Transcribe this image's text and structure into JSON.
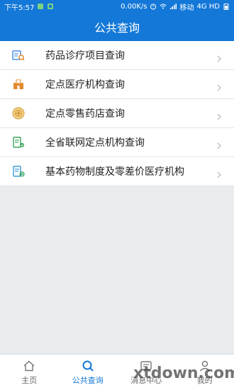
{
  "status_bar": {
    "time": "下午5:57",
    "network_speed": "0.00K/s",
    "carrier": "移动",
    "network_type": "4G HD"
  },
  "header": {
    "title": "公共查询"
  },
  "menu": {
    "items": [
      {
        "label": "药品诊疗项目查询",
        "icon": "medicine-search-icon"
      },
      {
        "label": "定点医疗机构查询",
        "icon": "hospital-icon"
      },
      {
        "label": "定点零售药店查询",
        "icon": "pharmacy-icon"
      },
      {
        "label": "全省联网定点机构查询",
        "icon": "network-institution-icon"
      },
      {
        "label": "基本药物制度及零差价医疗机构",
        "icon": "essential-drug-icon"
      }
    ]
  },
  "bottom_nav": {
    "items": [
      {
        "label": "主页",
        "icon": "home-icon",
        "active": false
      },
      {
        "label": "公共查询",
        "icon": "search-icon",
        "active": true
      },
      {
        "label": "消息中心",
        "icon": "message-icon",
        "active": false
      },
      {
        "label": "我的",
        "icon": "profile-icon",
        "active": false
      }
    ]
  },
  "watermark": "xtdown.com",
  "colors": {
    "primary": "#1478d8",
    "background": "#e9ecef",
    "icon_accent": "#e08a2e"
  }
}
